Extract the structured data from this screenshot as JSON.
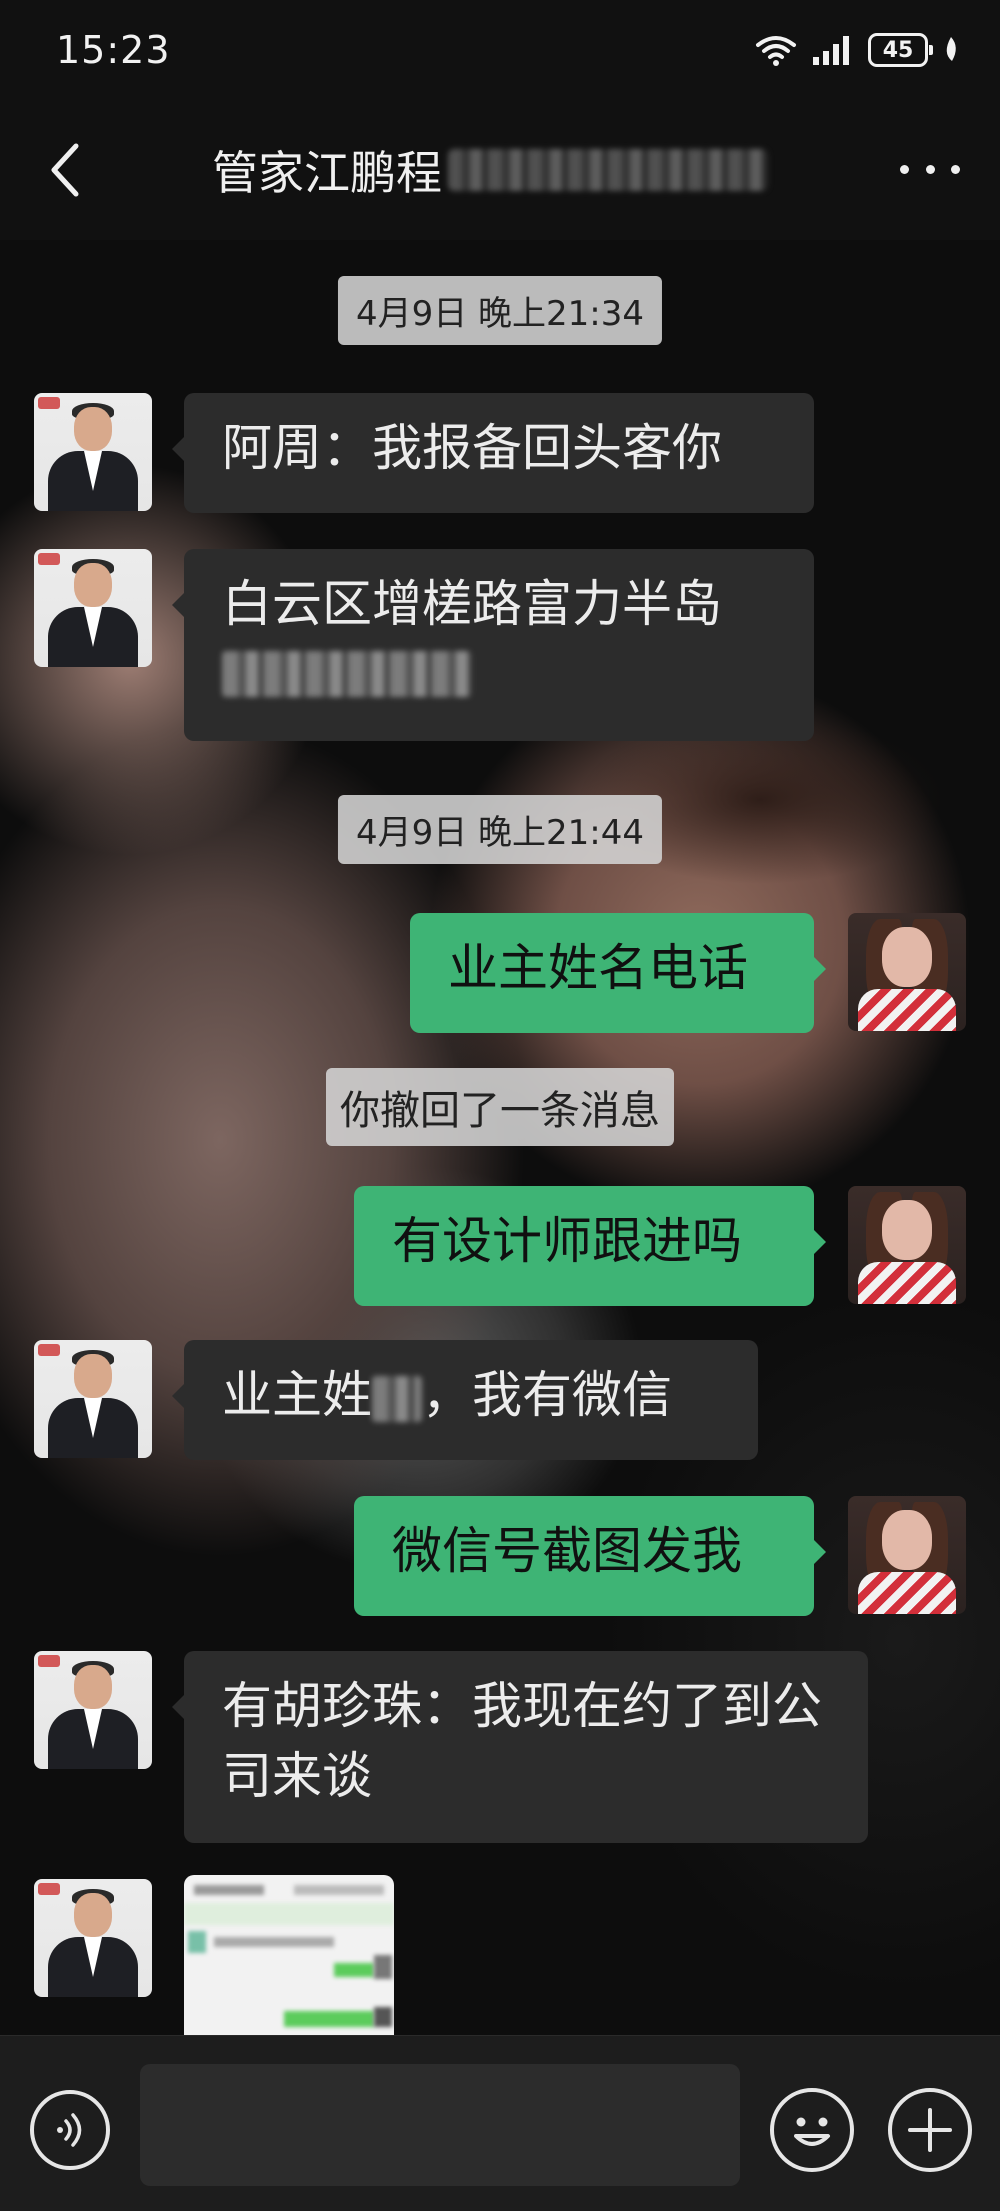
{
  "status_bar": {
    "time": "15:23",
    "battery_level": "45",
    "icons": [
      "wifi-icon",
      "signal-icon",
      "battery-icon",
      "leaf-icon"
    ]
  },
  "header": {
    "title": "管家江鹏程",
    "back_icon": "chevron-left-icon",
    "more_icon": "more-horizontal-icon"
  },
  "chat": {
    "timestamps": [
      "4月9日 晚上21:34",
      "4月9日 晚上21:44"
    ],
    "recall_notice": "你撤回了一条消息",
    "messages": [
      {
        "side": "in",
        "text": "阿周：我报备回头客你"
      },
      {
        "side": "in",
        "text": "白云区增槎路富力半岛"
      },
      {
        "side": "out",
        "text": "业主姓名电话"
      },
      {
        "side": "out",
        "text": "有设计师跟进吗"
      },
      {
        "side": "in",
        "text_before": "业主姓",
        "text_after": "，我有微信"
      },
      {
        "side": "out",
        "text": "微信号截图发我"
      },
      {
        "side": "in",
        "text": "有胡珍珠：我现在约了到公司来谈"
      },
      {
        "side": "in",
        "type": "image"
      }
    ]
  },
  "input_bar": {
    "voice_icon": "voice-icon",
    "emoji_icon": "emoji-icon",
    "plus_icon": "plus-icon",
    "input_value": ""
  }
}
